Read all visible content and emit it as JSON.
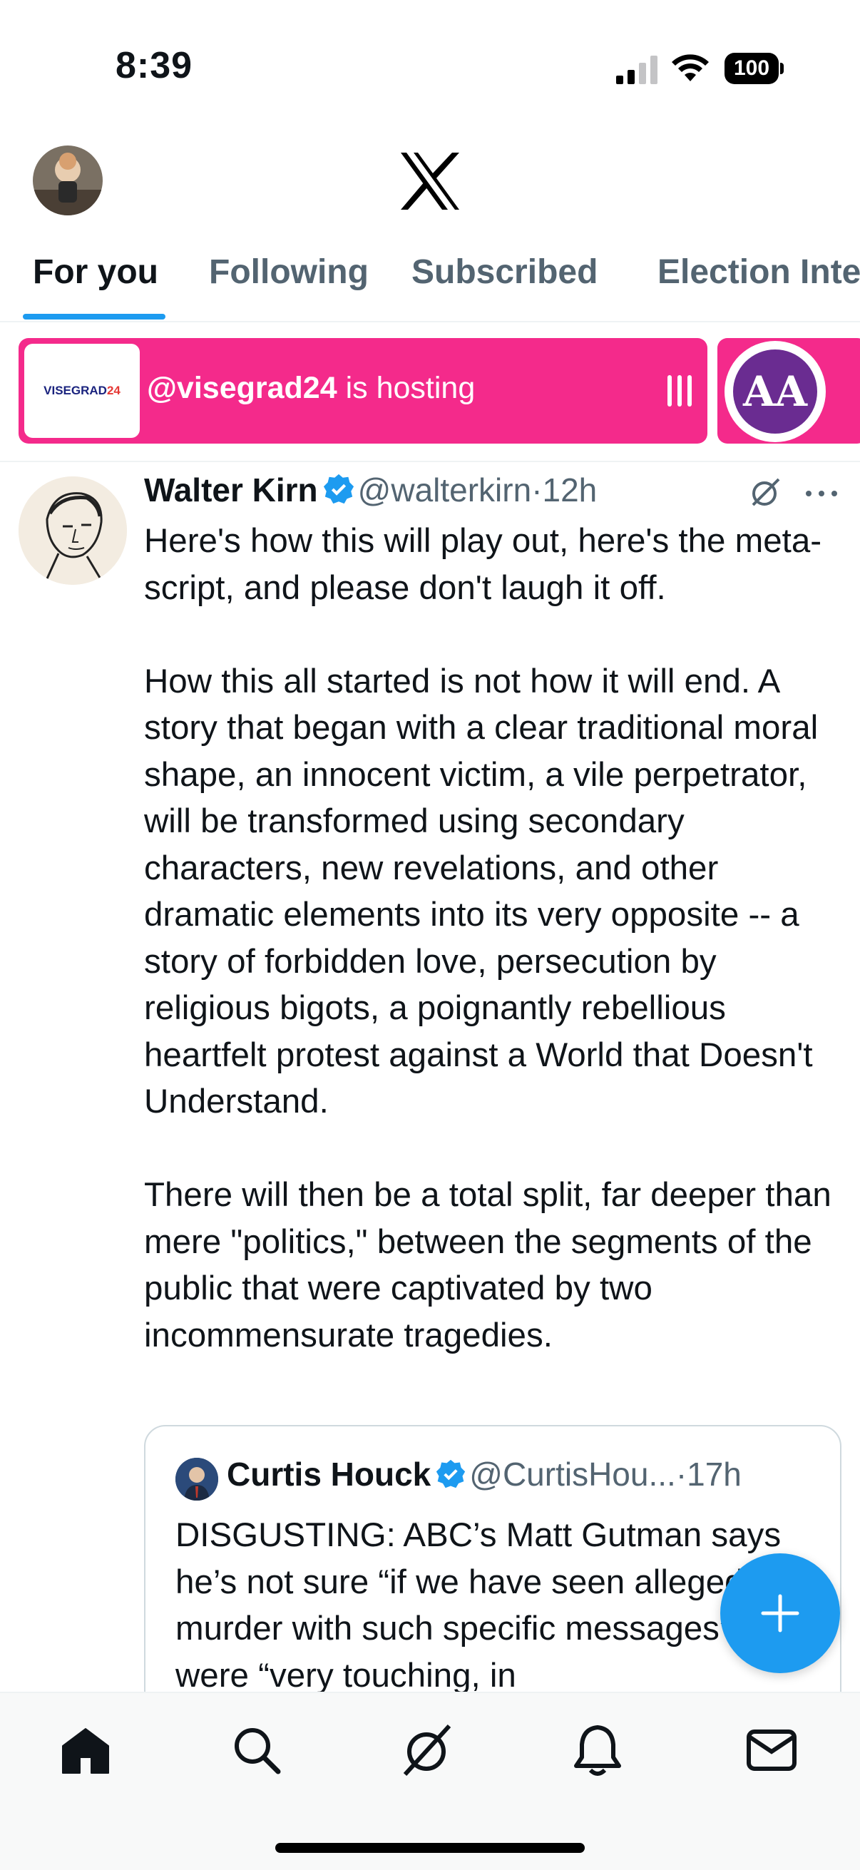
{
  "status_bar": {
    "time": "8:39",
    "battery": "100"
  },
  "tabs": [
    {
      "label": "For you",
      "active": true
    },
    {
      "label": "Following",
      "active": false
    },
    {
      "label": "Subscribed",
      "active": false
    },
    {
      "label": "Election Inte",
      "active": false
    }
  ],
  "spaces": {
    "logo_text": "VISEGRAD",
    "logo_num": "24",
    "host_handle": "@visegrad24",
    "host_suffix": " is hosting",
    "second_logo": "AA",
    "accent": "#f42a8b"
  },
  "tweet": {
    "name": "Walter Kirn",
    "handle": "@walterkirn",
    "dot": "·",
    "time": "12h",
    "paragraphs": [
      "Here's how this will play out, here's the meta-script, and please don't laugh it off.",
      "How this all started is not how it will end. A story that began with a clear traditional moral shape, an innocent victim, a vile perpetrator, will be transformed using secondary characters, new revelations, and other dramatic elements into its very opposite -- a story of forbidden love, persecution by religious bigots, a poignantly rebellious heartfelt protest against a World that Doesn't Understand.",
      "There will then be a total split, far deeper than mere \"politics,\" between the segments of the public that were captivated by two incommensurate tragedies."
    ],
    "quote": {
      "name": "Curtis Houck",
      "handle": "@CurtisHou...",
      "dot": "·",
      "time": "17h",
      "text": "DISGUSTING: ABC’s Matt Gutman says he’s not sure “if we have seen alleged murder with such specific messages” that were “very touching, in"
    }
  },
  "colors": {
    "accent": "#1d9bf0",
    "text": "#0f1419",
    "muted": "#536471"
  },
  "nav": [
    "home-icon",
    "search-icon",
    "grok-icon",
    "notifications-icon",
    "messages-icon"
  ]
}
